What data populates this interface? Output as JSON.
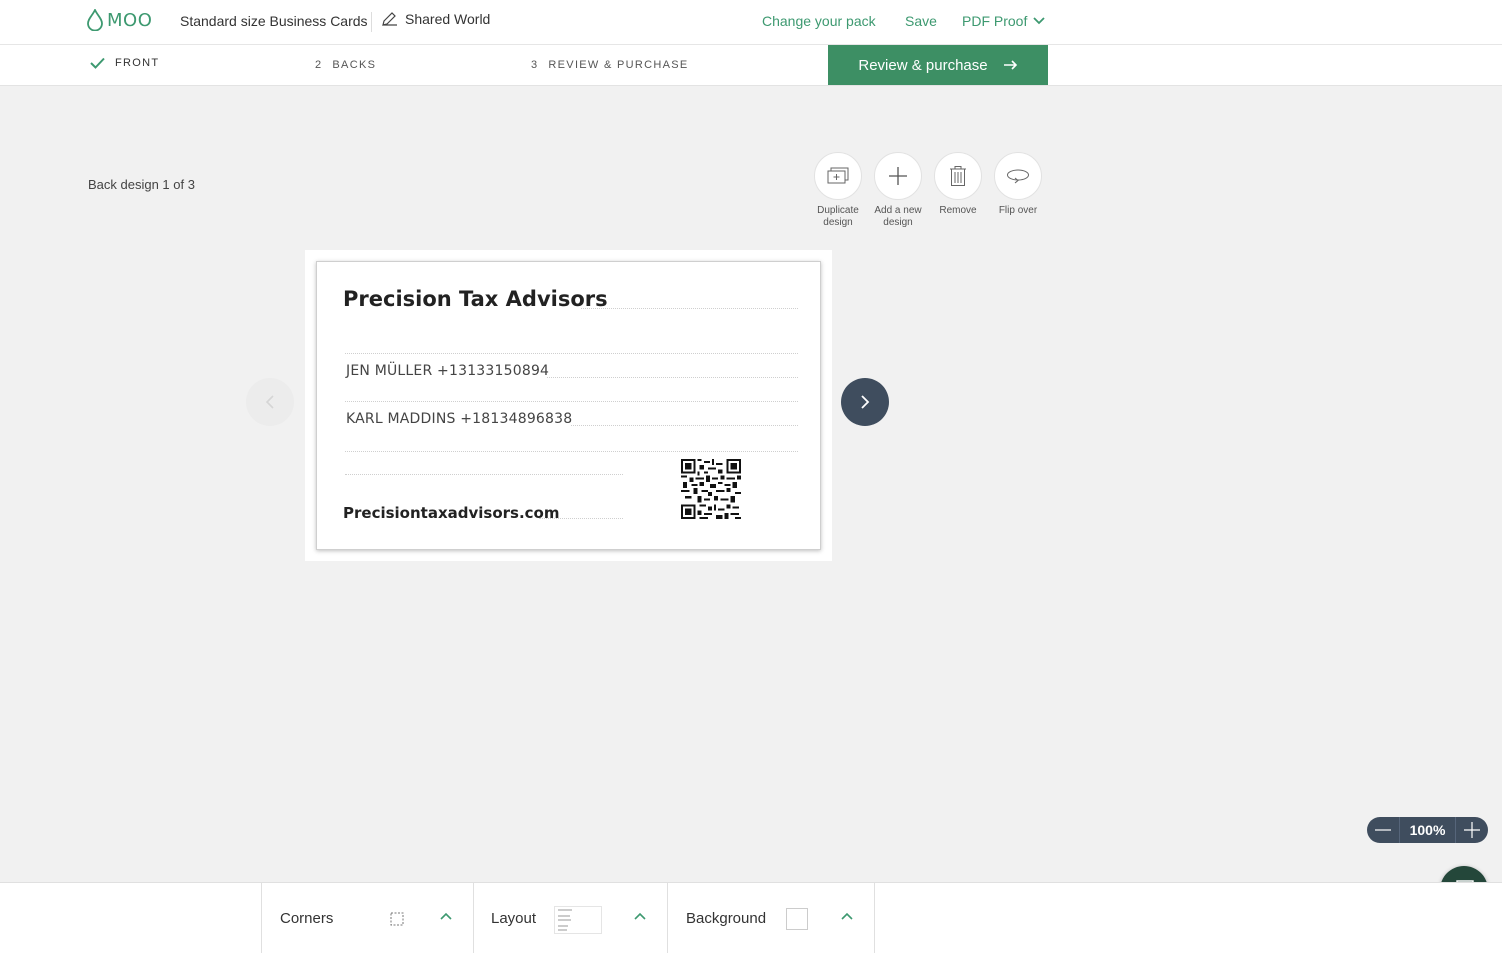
{
  "header": {
    "logo_text": "MOO",
    "product_title": "Standard size Business Cards",
    "world_name": "Shared World",
    "links": {
      "change_pack": "Change your pack",
      "save": "Save",
      "pdf_proof": "PDF Proof"
    }
  },
  "steps": {
    "front": "FRONT",
    "backs_num": "2",
    "backs": "BACKS",
    "review_num": "3",
    "review": "REVIEW & PURCHASE",
    "review_button": "Review & purchase"
  },
  "editor": {
    "back_label": "Back design 1 of 3",
    "tools": {
      "duplicate": "Duplicate design",
      "add": "Add a new design",
      "remove": "Remove",
      "flip": "Flip over"
    }
  },
  "card": {
    "title": "Precision Tax Advisors",
    "line1": "JEN MÜLLER +13133150894",
    "line2": "KARL MADDINS +18134896838",
    "website": "Precisiontaxadvisors.com"
  },
  "zoom": {
    "value": "100%"
  },
  "bottom": {
    "corners": "Corners",
    "layout": "Layout",
    "background": "Background"
  },
  "colors": {
    "accent": "#3d9970",
    "button_green": "#3d8f64",
    "slate": "#3f4d5e",
    "chat": "#24473a"
  }
}
